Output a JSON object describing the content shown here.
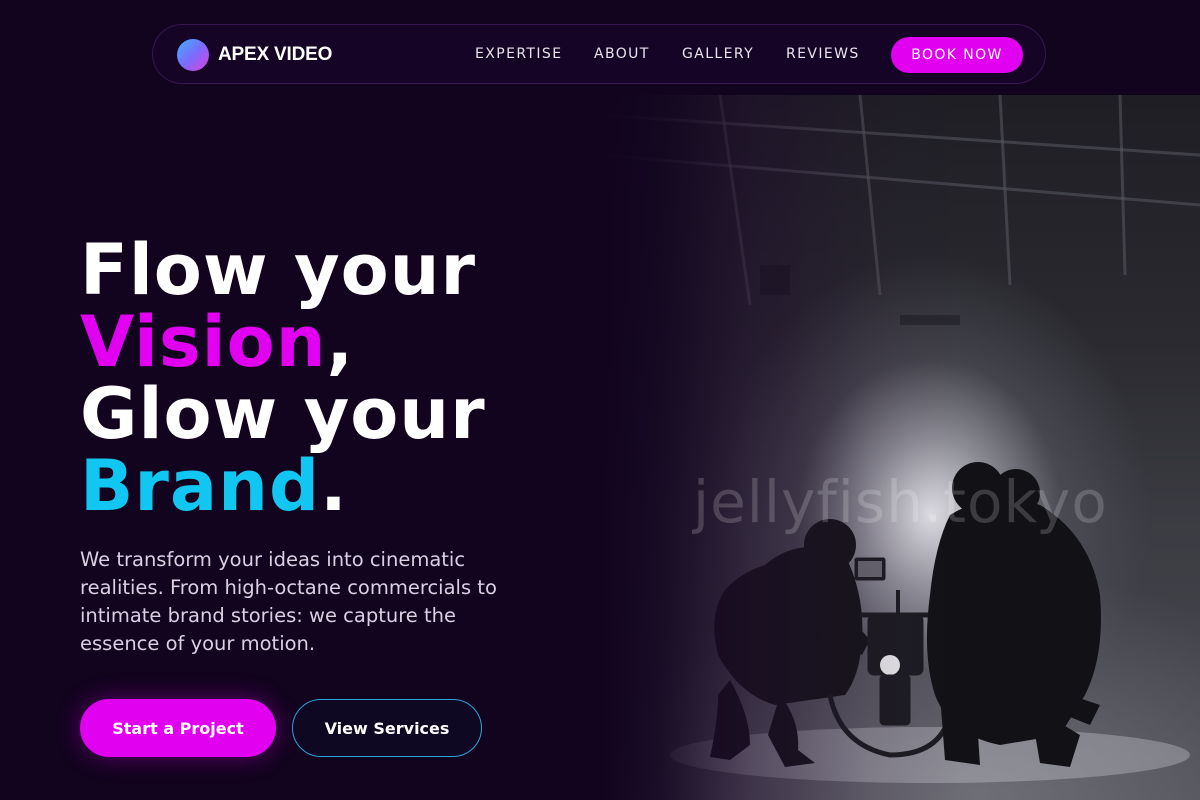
{
  "brand": {
    "name": "APEX VIDEO",
    "logo_icon": "gradient-circle-logo"
  },
  "nav": {
    "items": [
      {
        "label": "EXPERTISE"
      },
      {
        "label": "ABOUT"
      },
      {
        "label": "GALLERY"
      },
      {
        "label": "REVIEWS"
      }
    ],
    "book_label": "BOOK NOW"
  },
  "hero": {
    "headline": {
      "line1": "Flow your",
      "line2_accent": "Vision",
      "line2_rest": ",",
      "line3": "Glow your",
      "line4_accent": "Brand",
      "line4_rest": "."
    },
    "description": "We transform your ideas into cinematic realities. From high-octane commercials to intimate brand stories: we capture the essence of your motion.",
    "primary_cta": "Start a Project",
    "secondary_cta": "View Services",
    "image_watermark": "jellyfish.tokyo"
  },
  "colors": {
    "background": "#12031f",
    "accent_magenta": "#e100f0",
    "accent_cyan": "#12c6f2",
    "text_primary": "#ffffff",
    "text_muted": "#d9d0e2"
  }
}
